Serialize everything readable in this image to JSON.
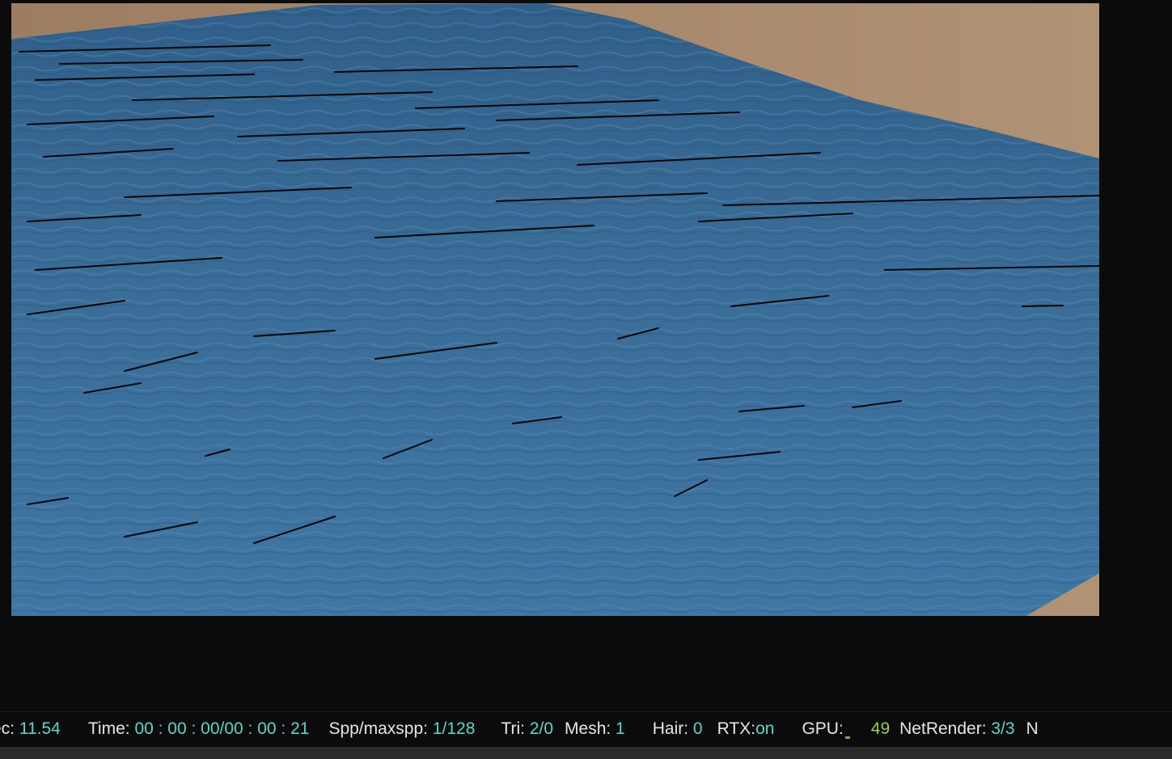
{
  "viewport": {
    "render_image": "ocean-water-surface-render"
  },
  "statusbar": {
    "sec_label": "ec:",
    "sec_value": "11.54",
    "time_label": "Time:",
    "time_value": "00 : 00 : 00/00 : 00 : 21",
    "spp_label": "Spp/maxspp:",
    "spp_value": "1/128",
    "tri_label": "Tri:",
    "tri_value": "2/0",
    "mesh_label": "Mesh:",
    "mesh_value": "1",
    "hair_label": "Hair:",
    "hair_value": "0",
    "rtx_label": "RTX:",
    "rtx_value": "on",
    "gpu_label": "GPU:",
    "gpu_value": "49",
    "netrender_label": "NetRender:",
    "netrender_value": "3/3",
    "trailing_label": "N"
  },
  "colors": {
    "background": "#0b0b0b",
    "water": "#3d6e99",
    "ground": "#a8896c",
    "value_cyan": "#57d7c7",
    "value_green": "#8fd04a"
  }
}
